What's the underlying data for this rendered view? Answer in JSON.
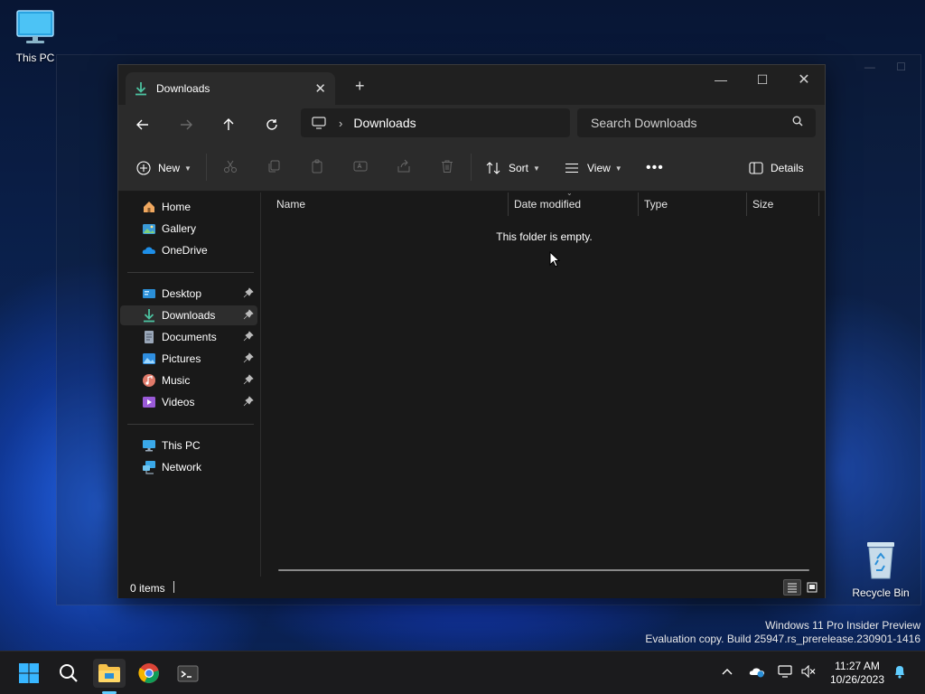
{
  "desktop": {
    "icons": [
      {
        "label": "This PC"
      },
      {
        "label": "Recycle Bin"
      }
    ],
    "watermark": {
      "line1": "Windows 11 Pro Insider Preview",
      "line2": "Evaluation copy. Build 25947.rs_prerelease.230901-1416"
    }
  },
  "window": {
    "tab": {
      "label": "Downloads"
    },
    "addressbar": {
      "path": [
        "Downloads"
      ],
      "search_placeholder": "Search Downloads"
    },
    "commandbar": {
      "new_label": "New",
      "sort_label": "Sort",
      "view_label": "View",
      "details_label": "Details"
    },
    "nav_pane": {
      "group1": [
        {
          "label": "Home"
        },
        {
          "label": "Gallery"
        },
        {
          "label": "OneDrive"
        }
      ],
      "group2": [
        {
          "label": "Desktop",
          "pinned": true
        },
        {
          "label": "Downloads",
          "pinned": true,
          "selected": true
        },
        {
          "label": "Documents",
          "pinned": true
        },
        {
          "label": "Pictures",
          "pinned": true
        },
        {
          "label": "Music",
          "pinned": true
        },
        {
          "label": "Videos",
          "pinned": true
        }
      ],
      "group3": [
        {
          "label": "This PC"
        },
        {
          "label": "Network"
        }
      ]
    },
    "columns": [
      "Name",
      "Date modified",
      "Type",
      "Size"
    ],
    "empty_message": "This folder is empty.",
    "status": {
      "items_text": "0 items"
    }
  },
  "taskbar": {
    "clock": {
      "time": "11:27 AM",
      "date": "10/26/2023"
    }
  },
  "colors": {
    "accent": "#60cdff",
    "download_green": "#4cc2a0",
    "window_bg": "#191919",
    "bar_bg": "#2b2b2b"
  },
  "icons": {
    "tab": "download-arrow-icon",
    "back": "arrow-left-icon",
    "forward": "arrow-right-icon",
    "up": "arrow-up-icon",
    "refresh": "refresh-icon",
    "monitor": "monitor-icon",
    "search": "search-icon"
  }
}
